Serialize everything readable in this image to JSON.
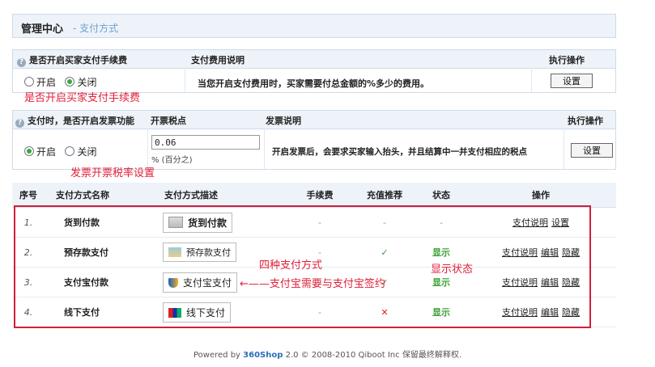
{
  "header": {
    "title": "管理中心",
    "sep": "-",
    "subtitle": "支付方式"
  },
  "fee": {
    "head_question": "是否开启买家支付手续费",
    "head_desc": "支付费用说明",
    "head_op": "执行操作",
    "opt_on": "开启",
    "opt_off": "关闭",
    "selected": "关闭",
    "desc": "当您开启支付费用时，买家需要付总金额的%多少的费用。",
    "btn": "设置",
    "annotation": "是否开启买家支付手续费"
  },
  "invoice": {
    "head_question": "支付时，是否开启发票功能",
    "head_rate": "开票税点",
    "head_desc": "发票说明",
    "head_op": "执行操作",
    "opt_on": "开启",
    "opt_off": "关闭",
    "selected": "开启",
    "rate_value": "0.06",
    "rate_unit": "% (百分之)",
    "desc": "开启发票后，会要求买家输入抬头，并且结算中一并支付相应的税点",
    "btn": "设置",
    "annotation": "发票开票税率设置"
  },
  "table": {
    "columns": [
      "序号",
      "支付方式名称",
      "支付方式描述",
      "手续费",
      "充值推荐",
      "状态",
      "操作"
    ],
    "rows": [
      {
        "no": "1.",
        "name": "货到付款",
        "logo": "货到付款",
        "fee": "-",
        "recommend": "-",
        "status": "-",
        "ops": [
          "支付说明",
          "设置"
        ]
      },
      {
        "no": "2.",
        "name": "预存款支付",
        "logo": "预存款支付",
        "fee": "-",
        "recommend": "✓",
        "status": "显示",
        "ops": [
          "支付说明",
          "编辑",
          "隐藏"
        ]
      },
      {
        "no": "3.",
        "name": "支付宝付款",
        "logo": "支付宝支付",
        "fee": "-",
        "recommend": "✓",
        "status": "显示",
        "ops": [
          "支付说明",
          "编辑",
          "隐藏"
        ]
      },
      {
        "no": "4.",
        "name": "线下支付",
        "logo": "线下支付",
        "fee": "-",
        "recommend": "✕",
        "status": "显示",
        "ops": [
          "支付说明",
          "编辑",
          "隐藏"
        ]
      }
    ]
  },
  "annotations": {
    "four_methods": "四种支付方式",
    "show_status": "显示状态",
    "alipay_note": "←——支付宝需要与支付宝签约"
  },
  "footer": {
    "prefix": "Powered by",
    "brand": "360Shop",
    "rest": "2.0 © 2008-2010 Qiboot Inc 保留最终解释权."
  },
  "colors": {
    "accent": "#2a6db8",
    "annotation_red": "#e0203a",
    "status_green": "#3aa035",
    "header_bg": "#eef3f9"
  }
}
